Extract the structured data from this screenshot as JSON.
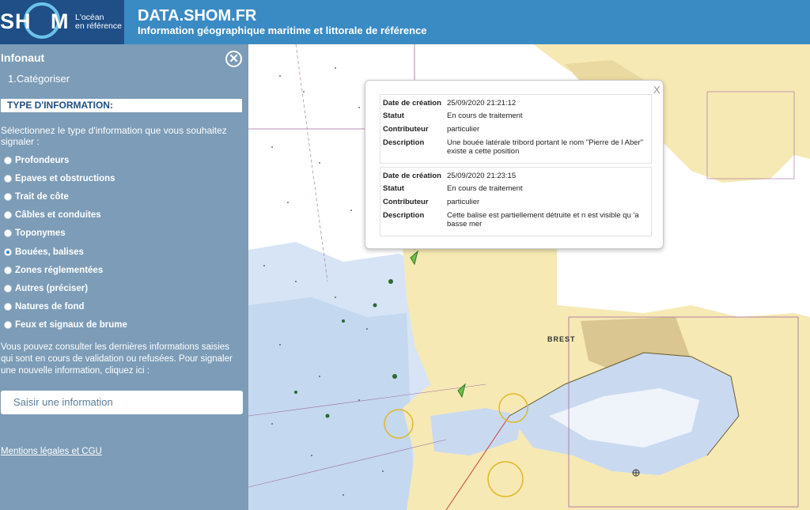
{
  "header": {
    "logo_left": "SH",
    "logo_right": "M",
    "logo_tagline_1": "L'océan",
    "logo_tagline_2": "en référence",
    "title": "DATA.SHOM.FR",
    "subtitle": "Information géographique maritime et littorale de référence"
  },
  "sidebar": {
    "title": "Infonaut",
    "close_symbol": "✕",
    "step": "1.Catégoriser",
    "section_heading": "TYPE D'INFORMATION:",
    "instructions": "Sélectionnez le type d'information que vous souhaitez signaler :",
    "options": [
      {
        "label": "Profondeurs",
        "selected": false
      },
      {
        "label": "Epaves et obstructions",
        "selected": false
      },
      {
        "label": "Trait de côte",
        "selected": false
      },
      {
        "label": "Câbles et conduites",
        "selected": false
      },
      {
        "label": "Toponymes",
        "selected": false
      },
      {
        "label": "Bouées, balises",
        "selected": true
      },
      {
        "label": "Zones réglementées",
        "selected": false
      },
      {
        "label": "Autres (préciser)",
        "selected": false
      },
      {
        "label": "Natures de fond",
        "selected": false
      },
      {
        "label": "Feux et signaux de brume",
        "selected": false
      }
    ],
    "info_text": "Vous pouvez consulter les dernières informations saisies qui sont en cours de validation ou refusées. Pour signaler une nouvelle information, cliquez ici :",
    "submit_button": "Saisir une information",
    "legal_link": "Mentions légales et CGU"
  },
  "map": {
    "place_label": "BREST"
  },
  "popup": {
    "close_symbol": "X",
    "records": [
      {
        "rows": [
          {
            "key": "Date de création",
            "value": "25/09/2020 21:21:12"
          },
          {
            "key": "Statut",
            "value": "En cours de traitement"
          },
          {
            "key": "Contributeur",
            "value": "particulier"
          },
          {
            "key": "Description",
            "value": "Une bouée latérale tribord portant le nom \"Pierre de l Aber\" existe a cette position"
          }
        ]
      },
      {
        "rows": [
          {
            "key": "Date de création",
            "value": "25/09/2020 21:23:15"
          },
          {
            "key": "Statut",
            "value": "En cours de traitement"
          },
          {
            "key": "Contributeur",
            "value": "particulier"
          },
          {
            "key": "Description",
            "value": "Cette balise est partiellement détruite et n est visible qu 'a basse mer"
          }
        ]
      }
    ]
  },
  "colors": {
    "header_blue": "#3a8bc4",
    "logo_navy": "#1f4f86",
    "sidebar_blue": "#7c9cb7",
    "land_yellow": "#f6e9b4",
    "shallow_water": "#c9daf0",
    "marker_green": "#6cc04a"
  }
}
